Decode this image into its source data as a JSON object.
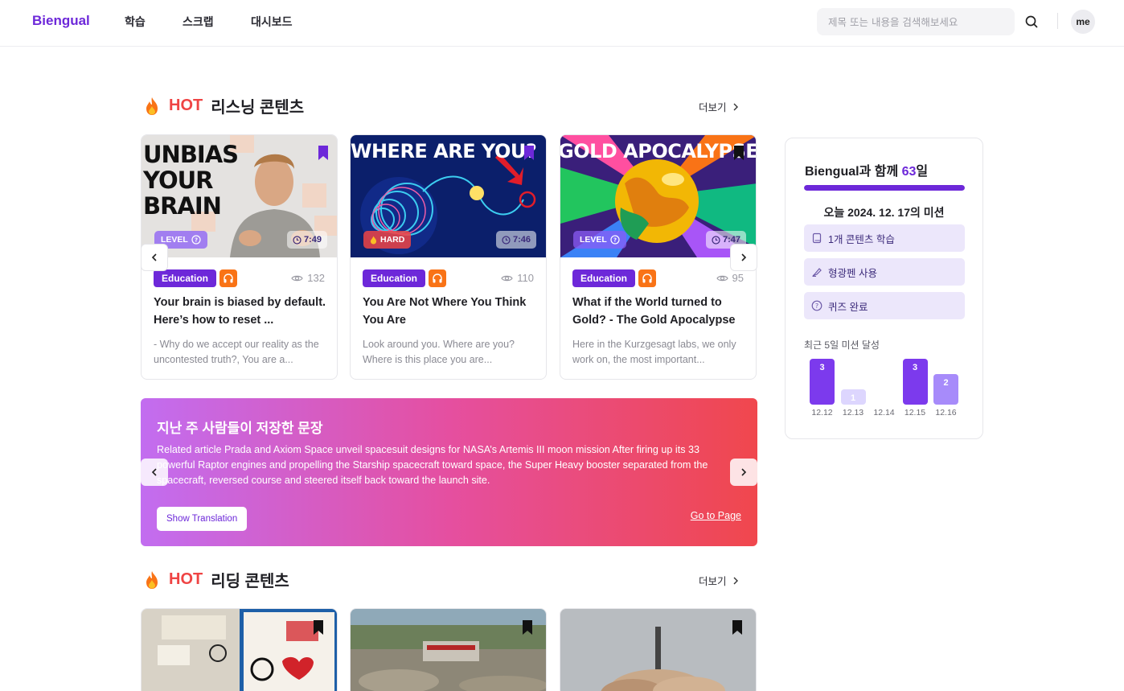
{
  "header": {
    "logo": "Biengual",
    "nav": [
      "학습",
      "스크랩",
      "대시보드"
    ],
    "search_placeholder": "제목 또는 내용을 검색해보세요",
    "avatar": "me"
  },
  "listening": {
    "title_hot": "HOT",
    "title_rest": "리스닝 콘텐츠",
    "more": "더보기",
    "cards": [
      {
        "thumb_text": "UNBIAS YOUR BRAIN",
        "level": "LEVEL",
        "time": "7:49",
        "category": "Education",
        "views": "132",
        "title": "Your brain is biased by default. Here’s how to reset ...",
        "desc": "- Why do we accept our reality as the uncontested truth?, You are a..."
      },
      {
        "thumb_text": "WHERE ARE YOU?",
        "level": "HARD",
        "time": "7:46",
        "category": "Education",
        "views": "110",
        "title": "You Are Not Where You Think You Are",
        "desc": "Look around you. Where are you? Where is this place you are..."
      },
      {
        "thumb_text": "GOLD APOCALYPSE",
        "level": "LEVEL",
        "time": "7:47",
        "category": "Education",
        "views": "95",
        "title": "What if the World turned to Gold? - The Gold Apocalypse",
        "desc": "Here in the Kurzgesagt labs, we only work on, the most important..."
      }
    ]
  },
  "banner": {
    "title": "지난 주 사람들이 저장한 문장",
    "text": "Related article Prada and Axiom Space unveil spacesuit designs for NASA’s Artemis III moon mission After firing up its 33 powerful Raptor engines and propelling the Starship spacecraft toward space, the Super Heavy booster separated from the spacecraft, reversed course and steered itself back toward the launch site.",
    "show_translation": "Show Translation",
    "go_to_page": "Go to Page"
  },
  "reading": {
    "title_hot": "HOT",
    "title_rest": "리딩 콘텐츠",
    "more": "더보기"
  },
  "side": {
    "title_prefix": "Biengual과 함께 ",
    "days": "63",
    "title_suffix": "일",
    "progress": 1.0,
    "mission_date": "오늘 2024. 12. 17의 미션",
    "missions": [
      "1개 콘텐츠 학습",
      "형광펜 사용",
      "퀴즈 완료"
    ],
    "recent_label": "최근 5일 미션 달성",
    "bars": [
      {
        "date": "12.12",
        "value": 3
      },
      {
        "date": "12.13",
        "value": 1
      },
      {
        "date": "12.14",
        "value": 0
      },
      {
        "date": "12.15",
        "value": 3
      },
      {
        "date": "12.16",
        "value": 2
      }
    ]
  },
  "colors": {
    "brand": "#6d28d9",
    "hot": "#ef4444",
    "audio": "#f97316"
  }
}
